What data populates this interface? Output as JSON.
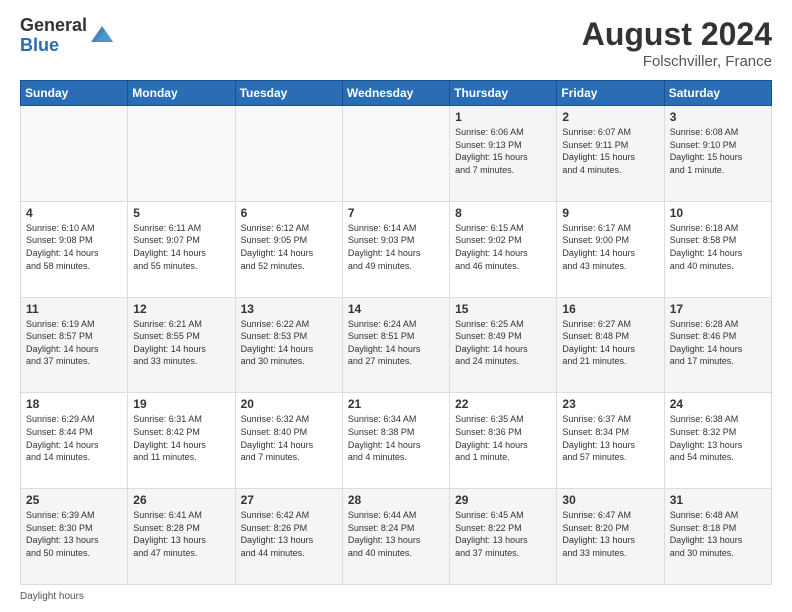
{
  "header": {
    "logo_general": "General",
    "logo_blue": "Blue",
    "month_year": "August 2024",
    "location": "Folschviller, France"
  },
  "days_of_week": [
    "Sunday",
    "Monday",
    "Tuesday",
    "Wednesday",
    "Thursday",
    "Friday",
    "Saturday"
  ],
  "weeks": [
    [
      {
        "day": "",
        "info": ""
      },
      {
        "day": "",
        "info": ""
      },
      {
        "day": "",
        "info": ""
      },
      {
        "day": "",
        "info": ""
      },
      {
        "day": "1",
        "info": "Sunrise: 6:06 AM\nSunset: 9:13 PM\nDaylight: 15 hours\nand 7 minutes."
      },
      {
        "day": "2",
        "info": "Sunrise: 6:07 AM\nSunset: 9:11 PM\nDaylight: 15 hours\nand 4 minutes."
      },
      {
        "day": "3",
        "info": "Sunrise: 6:08 AM\nSunset: 9:10 PM\nDaylight: 15 hours\nand 1 minute."
      }
    ],
    [
      {
        "day": "4",
        "info": "Sunrise: 6:10 AM\nSunset: 9:08 PM\nDaylight: 14 hours\nand 58 minutes."
      },
      {
        "day": "5",
        "info": "Sunrise: 6:11 AM\nSunset: 9:07 PM\nDaylight: 14 hours\nand 55 minutes."
      },
      {
        "day": "6",
        "info": "Sunrise: 6:12 AM\nSunset: 9:05 PM\nDaylight: 14 hours\nand 52 minutes."
      },
      {
        "day": "7",
        "info": "Sunrise: 6:14 AM\nSunset: 9:03 PM\nDaylight: 14 hours\nand 49 minutes."
      },
      {
        "day": "8",
        "info": "Sunrise: 6:15 AM\nSunset: 9:02 PM\nDaylight: 14 hours\nand 46 minutes."
      },
      {
        "day": "9",
        "info": "Sunrise: 6:17 AM\nSunset: 9:00 PM\nDaylight: 14 hours\nand 43 minutes."
      },
      {
        "day": "10",
        "info": "Sunrise: 6:18 AM\nSunset: 8:58 PM\nDaylight: 14 hours\nand 40 minutes."
      }
    ],
    [
      {
        "day": "11",
        "info": "Sunrise: 6:19 AM\nSunset: 8:57 PM\nDaylight: 14 hours\nand 37 minutes."
      },
      {
        "day": "12",
        "info": "Sunrise: 6:21 AM\nSunset: 8:55 PM\nDaylight: 14 hours\nand 33 minutes."
      },
      {
        "day": "13",
        "info": "Sunrise: 6:22 AM\nSunset: 8:53 PM\nDaylight: 14 hours\nand 30 minutes."
      },
      {
        "day": "14",
        "info": "Sunrise: 6:24 AM\nSunset: 8:51 PM\nDaylight: 14 hours\nand 27 minutes."
      },
      {
        "day": "15",
        "info": "Sunrise: 6:25 AM\nSunset: 8:49 PM\nDaylight: 14 hours\nand 24 minutes."
      },
      {
        "day": "16",
        "info": "Sunrise: 6:27 AM\nSunset: 8:48 PM\nDaylight: 14 hours\nand 21 minutes."
      },
      {
        "day": "17",
        "info": "Sunrise: 6:28 AM\nSunset: 8:46 PM\nDaylight: 14 hours\nand 17 minutes."
      }
    ],
    [
      {
        "day": "18",
        "info": "Sunrise: 6:29 AM\nSunset: 8:44 PM\nDaylight: 14 hours\nand 14 minutes."
      },
      {
        "day": "19",
        "info": "Sunrise: 6:31 AM\nSunset: 8:42 PM\nDaylight: 14 hours\nand 11 minutes."
      },
      {
        "day": "20",
        "info": "Sunrise: 6:32 AM\nSunset: 8:40 PM\nDaylight: 14 hours\nand 7 minutes."
      },
      {
        "day": "21",
        "info": "Sunrise: 6:34 AM\nSunset: 8:38 PM\nDaylight: 14 hours\nand 4 minutes."
      },
      {
        "day": "22",
        "info": "Sunrise: 6:35 AM\nSunset: 8:36 PM\nDaylight: 14 hours\nand 1 minute."
      },
      {
        "day": "23",
        "info": "Sunrise: 6:37 AM\nSunset: 8:34 PM\nDaylight: 13 hours\nand 57 minutes."
      },
      {
        "day": "24",
        "info": "Sunrise: 6:38 AM\nSunset: 8:32 PM\nDaylight: 13 hours\nand 54 minutes."
      }
    ],
    [
      {
        "day": "25",
        "info": "Sunrise: 6:39 AM\nSunset: 8:30 PM\nDaylight: 13 hours\nand 50 minutes."
      },
      {
        "day": "26",
        "info": "Sunrise: 6:41 AM\nSunset: 8:28 PM\nDaylight: 13 hours\nand 47 minutes."
      },
      {
        "day": "27",
        "info": "Sunrise: 6:42 AM\nSunset: 8:26 PM\nDaylight: 13 hours\nand 44 minutes."
      },
      {
        "day": "28",
        "info": "Sunrise: 6:44 AM\nSunset: 8:24 PM\nDaylight: 13 hours\nand 40 minutes."
      },
      {
        "day": "29",
        "info": "Sunrise: 6:45 AM\nSunset: 8:22 PM\nDaylight: 13 hours\nand 37 minutes."
      },
      {
        "day": "30",
        "info": "Sunrise: 6:47 AM\nSunset: 8:20 PM\nDaylight: 13 hours\nand 33 minutes."
      },
      {
        "day": "31",
        "info": "Sunrise: 6:48 AM\nSunset: 8:18 PM\nDaylight: 13 hours\nand 30 minutes."
      }
    ]
  ],
  "footer": {
    "daylight_label": "Daylight hours"
  }
}
